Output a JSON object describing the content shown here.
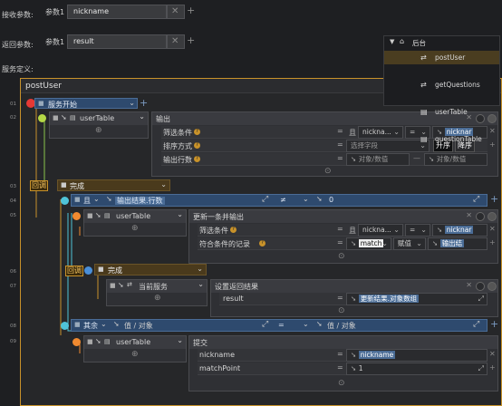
{
  "top": {
    "receive_params_label": "接收参数:",
    "return_params_label": "返回参数:",
    "service_def_label": "服务定义:",
    "param1_label": "参数1",
    "receive_param_value": "nickname",
    "return_param_value": "result"
  },
  "tree": {
    "root": "后台",
    "items": [
      "postUser",
      "getQuestions",
      "userTable",
      "questionTable"
    ]
  },
  "panel": {
    "title": "postUser",
    "gutter": [
      "01",
      "02",
      "03",
      "04",
      "05",
      "06",
      "07",
      "08",
      "09"
    ],
    "start_label": "服务开始",
    "user_table": "userTable",
    "output_label": "输出",
    "filter_label": "筛选条件",
    "sort_label": "排序方式",
    "rows_label": "输出行数",
    "field_nickname": "nickna...",
    "op_eq": "=",
    "val_nickname": "nicknar",
    "select_field": "选择字段",
    "asc": "升序",
    "desc": "降序",
    "obj_data": "对象/数值",
    "callback": "回调",
    "done": "完成",
    "and": "且",
    "output_count": "输出结果.行数",
    "neq": "≠",
    "zero": "0",
    "update_output": "更新一条并输出",
    "match_label": "符合条件的记录",
    "match": "match",
    "assign": "赋值",
    "output_result": "输出结",
    "current_service": "当前服务",
    "set_return": "设置返回结果",
    "result_key": "result",
    "update_result": "更新结果.对象数组",
    "other": "其余",
    "value_obj": "值 / 对象",
    "submit": "提交",
    "nickname": "nickname",
    "match_point": "matchPoint",
    "nickname_val": "nickname",
    "one": "1"
  }
}
